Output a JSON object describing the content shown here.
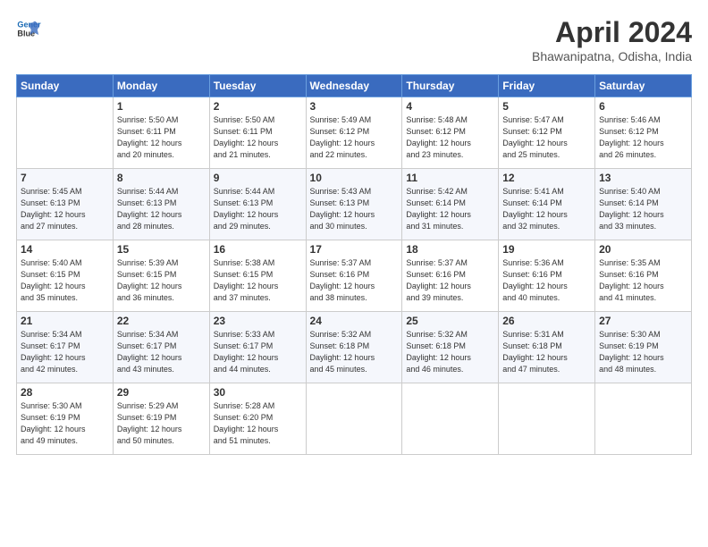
{
  "header": {
    "logo_line1": "General",
    "logo_line2": "Blue",
    "month": "April 2024",
    "location": "Bhawanipatna, Odisha, India"
  },
  "weekdays": [
    "Sunday",
    "Monday",
    "Tuesday",
    "Wednesday",
    "Thursday",
    "Friday",
    "Saturday"
  ],
  "weeks": [
    [
      {
        "day": "",
        "info": ""
      },
      {
        "day": "1",
        "info": "Sunrise: 5:50 AM\nSunset: 6:11 PM\nDaylight: 12 hours\nand 20 minutes."
      },
      {
        "day": "2",
        "info": "Sunrise: 5:50 AM\nSunset: 6:11 PM\nDaylight: 12 hours\nand 21 minutes."
      },
      {
        "day": "3",
        "info": "Sunrise: 5:49 AM\nSunset: 6:12 PM\nDaylight: 12 hours\nand 22 minutes."
      },
      {
        "day": "4",
        "info": "Sunrise: 5:48 AM\nSunset: 6:12 PM\nDaylight: 12 hours\nand 23 minutes."
      },
      {
        "day": "5",
        "info": "Sunrise: 5:47 AM\nSunset: 6:12 PM\nDaylight: 12 hours\nand 25 minutes."
      },
      {
        "day": "6",
        "info": "Sunrise: 5:46 AM\nSunset: 6:12 PM\nDaylight: 12 hours\nand 26 minutes."
      }
    ],
    [
      {
        "day": "7",
        "info": "Sunrise: 5:45 AM\nSunset: 6:13 PM\nDaylight: 12 hours\nand 27 minutes."
      },
      {
        "day": "8",
        "info": "Sunrise: 5:44 AM\nSunset: 6:13 PM\nDaylight: 12 hours\nand 28 minutes."
      },
      {
        "day": "9",
        "info": "Sunrise: 5:44 AM\nSunset: 6:13 PM\nDaylight: 12 hours\nand 29 minutes."
      },
      {
        "day": "10",
        "info": "Sunrise: 5:43 AM\nSunset: 6:13 PM\nDaylight: 12 hours\nand 30 minutes."
      },
      {
        "day": "11",
        "info": "Sunrise: 5:42 AM\nSunset: 6:14 PM\nDaylight: 12 hours\nand 31 minutes."
      },
      {
        "day": "12",
        "info": "Sunrise: 5:41 AM\nSunset: 6:14 PM\nDaylight: 12 hours\nand 32 minutes."
      },
      {
        "day": "13",
        "info": "Sunrise: 5:40 AM\nSunset: 6:14 PM\nDaylight: 12 hours\nand 33 minutes."
      }
    ],
    [
      {
        "day": "14",
        "info": "Sunrise: 5:40 AM\nSunset: 6:15 PM\nDaylight: 12 hours\nand 35 minutes."
      },
      {
        "day": "15",
        "info": "Sunrise: 5:39 AM\nSunset: 6:15 PM\nDaylight: 12 hours\nand 36 minutes."
      },
      {
        "day": "16",
        "info": "Sunrise: 5:38 AM\nSunset: 6:15 PM\nDaylight: 12 hours\nand 37 minutes."
      },
      {
        "day": "17",
        "info": "Sunrise: 5:37 AM\nSunset: 6:16 PM\nDaylight: 12 hours\nand 38 minutes."
      },
      {
        "day": "18",
        "info": "Sunrise: 5:37 AM\nSunset: 6:16 PM\nDaylight: 12 hours\nand 39 minutes."
      },
      {
        "day": "19",
        "info": "Sunrise: 5:36 AM\nSunset: 6:16 PM\nDaylight: 12 hours\nand 40 minutes."
      },
      {
        "day": "20",
        "info": "Sunrise: 5:35 AM\nSunset: 6:16 PM\nDaylight: 12 hours\nand 41 minutes."
      }
    ],
    [
      {
        "day": "21",
        "info": "Sunrise: 5:34 AM\nSunset: 6:17 PM\nDaylight: 12 hours\nand 42 minutes."
      },
      {
        "day": "22",
        "info": "Sunrise: 5:34 AM\nSunset: 6:17 PM\nDaylight: 12 hours\nand 43 minutes."
      },
      {
        "day": "23",
        "info": "Sunrise: 5:33 AM\nSunset: 6:17 PM\nDaylight: 12 hours\nand 44 minutes."
      },
      {
        "day": "24",
        "info": "Sunrise: 5:32 AM\nSunset: 6:18 PM\nDaylight: 12 hours\nand 45 minutes."
      },
      {
        "day": "25",
        "info": "Sunrise: 5:32 AM\nSunset: 6:18 PM\nDaylight: 12 hours\nand 46 minutes."
      },
      {
        "day": "26",
        "info": "Sunrise: 5:31 AM\nSunset: 6:18 PM\nDaylight: 12 hours\nand 47 minutes."
      },
      {
        "day": "27",
        "info": "Sunrise: 5:30 AM\nSunset: 6:19 PM\nDaylight: 12 hours\nand 48 minutes."
      }
    ],
    [
      {
        "day": "28",
        "info": "Sunrise: 5:30 AM\nSunset: 6:19 PM\nDaylight: 12 hours\nand 49 minutes."
      },
      {
        "day": "29",
        "info": "Sunrise: 5:29 AM\nSunset: 6:19 PM\nDaylight: 12 hours\nand 50 minutes."
      },
      {
        "day": "30",
        "info": "Sunrise: 5:28 AM\nSunset: 6:20 PM\nDaylight: 12 hours\nand 51 minutes."
      },
      {
        "day": "",
        "info": ""
      },
      {
        "day": "",
        "info": ""
      },
      {
        "day": "",
        "info": ""
      },
      {
        "day": "",
        "info": ""
      }
    ]
  ]
}
